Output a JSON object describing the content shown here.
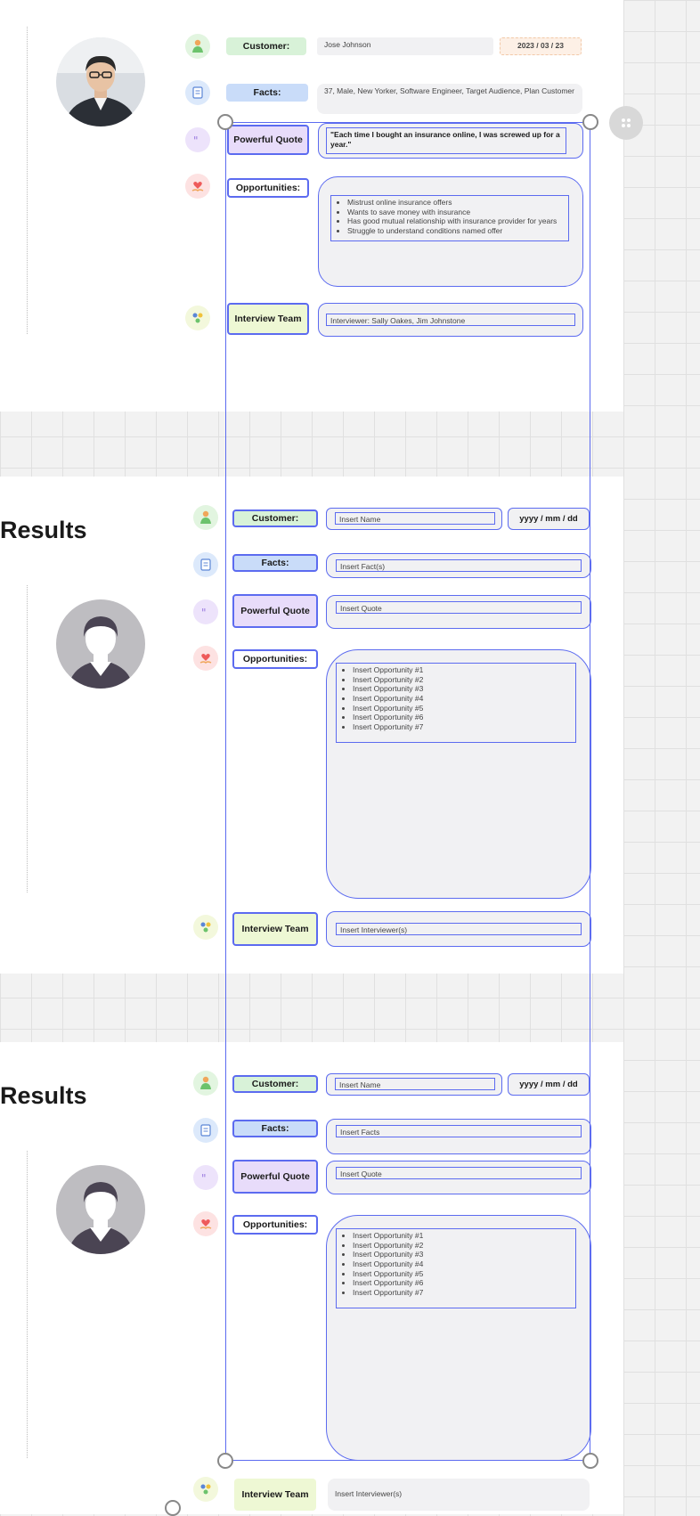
{
  "labels": {
    "customer": "Customer:",
    "facts": "Facts:",
    "quote": "Powerful Quote",
    "opportunities": "Opportunities:",
    "team": "Interview Team"
  },
  "section_title": "Results",
  "card1": {
    "customer": "Jose Johnson",
    "date": "2023 / 03 / 23",
    "facts": "37, Male, New Yorker, Software Engineer, Target Audience, Plan Customer",
    "quote": "\"Each time I bought an insurance online, I was screwed up for a year.\"",
    "opportunities": [
      "Mistrust online insurance offers",
      "Wants to save money with insurance",
      "Has good mutual relationship with insurance provider for years",
      "Struggle to understand conditions named offer"
    ],
    "team": "Interviewer: Sally Oakes, Jim Johnstone"
  },
  "card2": {
    "customer": "Insert Name",
    "date": "yyyy / mm / dd",
    "facts": "Insert Fact(s)",
    "quote": "Insert Quote",
    "opportunities": [
      "Insert Opportunity #1",
      "Insert Opportunity #2",
      "Insert Opportunity #3",
      "Insert Opportunity #4",
      "Insert Opportunity #5",
      "Insert Opportunity #6",
      "Insert Opportunity #7"
    ],
    "team": "Insert Interviewer(s)"
  },
  "card3": {
    "customer": "Insert Name",
    "date": "yyyy / mm / dd",
    "facts": "Insert Facts",
    "quote": "Insert Quote",
    "opportunities": [
      "Insert Opportunity #1",
      "Insert Opportunity #2",
      "Insert Opportunity #3",
      "Insert Opportunity #4",
      "Insert Opportunity #5",
      "Insert Opportunity #6",
      "Insert Opportunity #7"
    ],
    "team": "Insert Interviewer(s)"
  },
  "colors": {
    "selection": "#5c6bf0",
    "customer_label": "#d8f2d8",
    "facts_label": "#c9dcf9",
    "quote_label": "#e8dcfa",
    "team_label": "#eef8d4"
  },
  "icons": [
    "person-icon",
    "document-icon",
    "quote-icon",
    "heart-hand-icon",
    "team-icon",
    "grip-icon"
  ]
}
